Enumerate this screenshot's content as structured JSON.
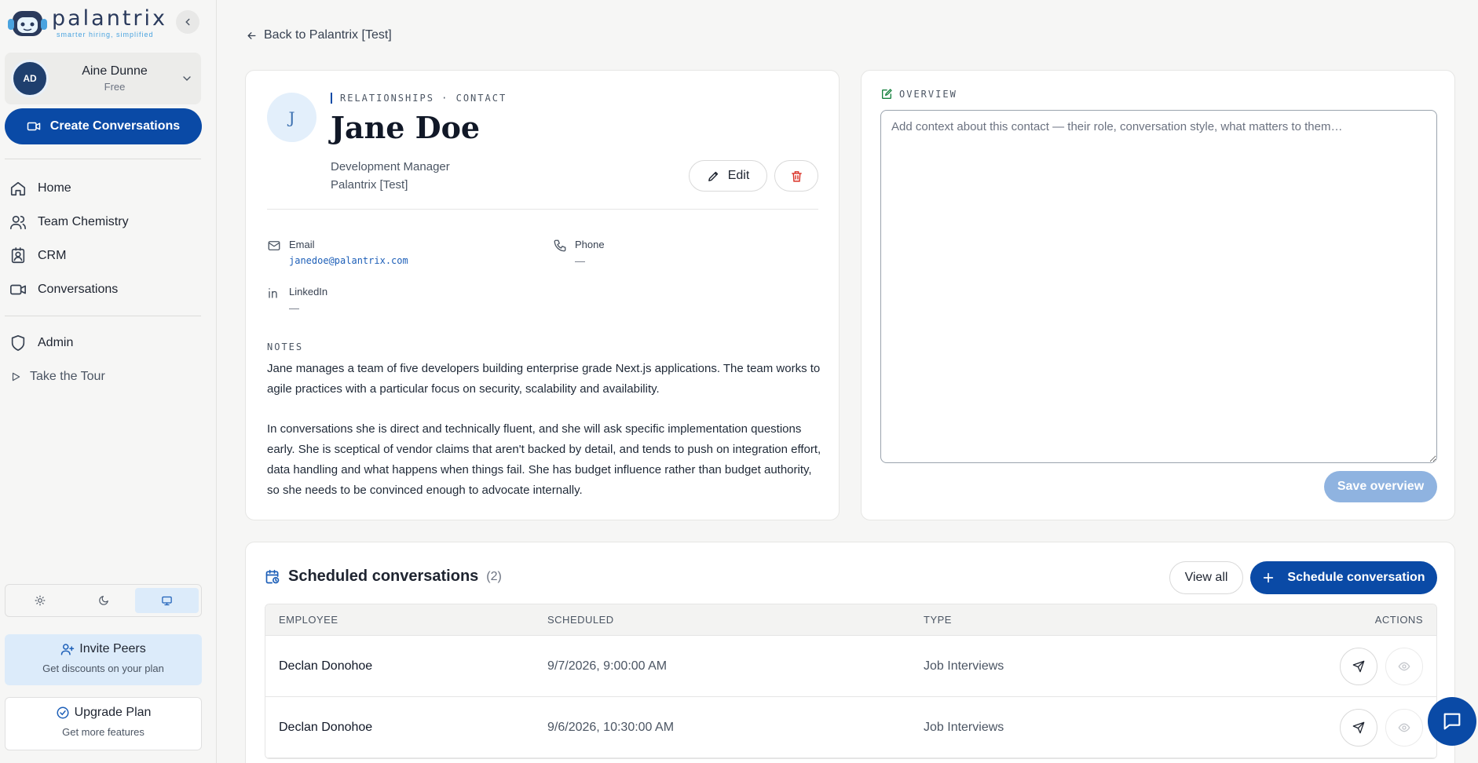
{
  "brand": {
    "name": "palantrix",
    "tagline": "smarter hiring, simplified"
  },
  "user": {
    "name": "Aine Dunne",
    "plan": "Free",
    "initials": "AD"
  },
  "sidebar": {
    "create_label": "Create Conversations",
    "items": [
      {
        "label": "Home",
        "icon": "home-icon"
      },
      {
        "label": "Team Chemistry",
        "icon": "users-icon"
      },
      {
        "label": "CRM",
        "icon": "contact-book-icon"
      },
      {
        "label": "Conversations",
        "icon": "video-icon"
      }
    ],
    "admin_label": "Admin",
    "tour_label": "Take the Tour",
    "theme_options": [
      "light",
      "dark",
      "system"
    ],
    "theme_selected": "system",
    "invite": {
      "title": "Invite Peers",
      "subtitle": "Get discounts on your plan"
    },
    "upgrade": {
      "title": "Upgrade Plan",
      "subtitle": "Get more features"
    }
  },
  "back_link": "Back to Palantrix [Test]",
  "contact": {
    "initial": "J",
    "eyebrow": "RELATIONSHIPS · CONTACT",
    "name": "Jane Doe",
    "role": "Development Manager",
    "company": "Palantrix [Test]",
    "edit_label": "Edit",
    "email_label": "Email",
    "email": "janedoe@palantrix.com",
    "phone_label": "Phone",
    "phone": "—",
    "linkedin_label": "LinkedIn",
    "linkedin": "—",
    "notes_label": "NOTES",
    "notes_p1": "Jane manages a team of five developers building enterprise grade Next.js applications. The team works to agile practices with a particular focus on security, scalability and availability.",
    "notes_p2": "In conversations she is direct and technically fluent, and she will ask specific implementation questions early. She is sceptical of vendor claims that aren't backed by detail, and tends to push on integration effort, data handling and what happens when things fail. She has budget influence rather than budget authority, so she needs to be convinced enough to advocate internally."
  },
  "overview": {
    "label": "OVERVIEW",
    "value": "",
    "placeholder": "Add context about this contact — their role, conversation style, what matters to them…",
    "save_label": "Save overview"
  },
  "scheduled": {
    "title": "Scheduled conversations",
    "count": "(2)",
    "view_all_label": "View all",
    "schedule_label": "Schedule conversation",
    "columns": [
      "EMPLOYEE",
      "SCHEDULED",
      "TYPE",
      "ACTIONS"
    ],
    "rows": [
      {
        "employee": "Declan Donohoe",
        "scheduled": "9/7/2026, 9:00:00 AM",
        "type": "Job Interviews"
      },
      {
        "employee": "Declan Donohoe",
        "scheduled": "9/6/2026, 10:30:00 AM",
        "type": "Job Interviews"
      }
    ]
  },
  "colors": {
    "primary": "#0a4aa6",
    "accent_light": "#dcebfa",
    "danger": "#d93025",
    "save_disabled": "#8fb3e0"
  }
}
